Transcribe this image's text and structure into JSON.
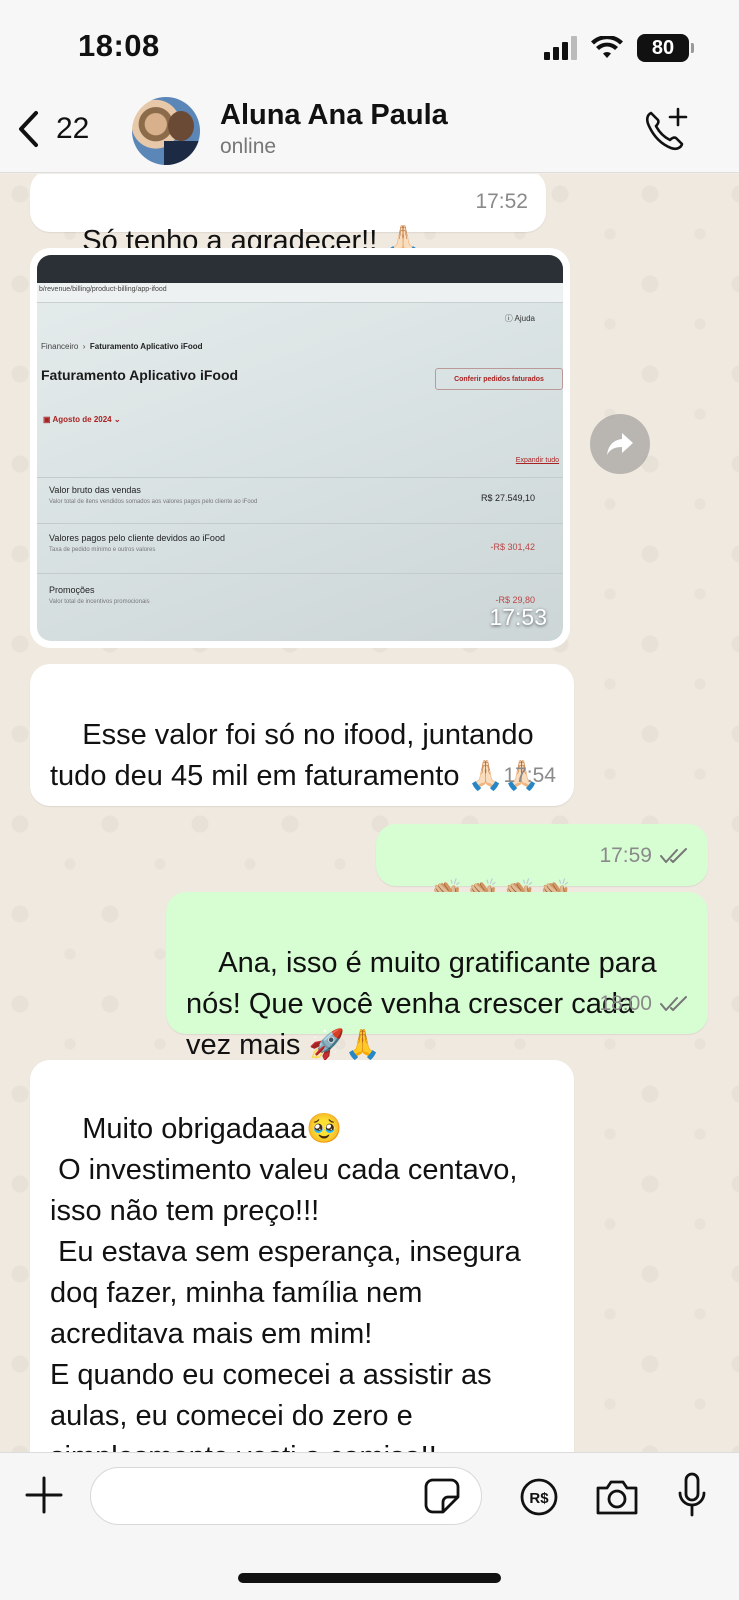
{
  "status_bar": {
    "time": "18:08",
    "battery": "80"
  },
  "header": {
    "back_count": "22",
    "contact_name": "Aluna Ana Paula",
    "contact_status": "online"
  },
  "messages": [
    {
      "direction": "in",
      "text": "Só tenho a agradecer!! 🙏🏻",
      "time": "17:52"
    },
    {
      "direction": "in",
      "type": "image",
      "time": "17:53",
      "image": {
        "url": "b/revenue/billing/product-billing/app-ifood",
        "help": "Ajuda",
        "breadcrumb_root": "Financeiro",
        "breadcrumb_current": "Faturamento Aplicativo iFood",
        "title": "Faturamento Aplicativo iFood",
        "action": "Conferir pedidos faturados",
        "month": "Agosto de 2024",
        "expand": "Expandir tudo",
        "rows": [
          {
            "label": "Valor bruto das vendas",
            "sub": "Valor total de itens vendidos somados aos valores pagos pelo cliente ao iFood",
            "value": "R$ 27.549,10"
          },
          {
            "label": "Valores pagos pelo cliente devidos ao iFood",
            "sub": "Taxa de pedido mínimo e outros valores",
            "value": "-R$ 301,42"
          },
          {
            "label": "Promoções",
            "sub": "Valor total de incentivos promocionais",
            "value": "-R$ 29,80"
          }
        ]
      }
    },
    {
      "direction": "in",
      "text": "Esse valor foi só no ifood, juntando tudo deu 45 mil em faturamento 🙏🏻🙏🏻",
      "time": "17:54"
    },
    {
      "direction": "out",
      "text": "👏🏼👏🏼👏🏼👏🏼",
      "time": "17:59"
    },
    {
      "direction": "out",
      "text": "Ana, isso é muito gratificante para nós! Que você venha crescer cada vez mais 🚀🙏",
      "time": "18:00"
    },
    {
      "direction": "in",
      "text": "Muito obrigadaaa🥹\n O investimento valeu cada centavo, isso não tem preço!!!\n Eu estava sem esperança, insegura doq fazer, minha família nem acreditava mais em mim!\nE quando eu comecei a assistir as aulas, eu comecei do zero e simplesmente vesti a camisa!!"
    }
  ],
  "icons": {
    "back": "chevron-left-icon",
    "call": "phone-add-icon",
    "forward": "forward-arrow-icon",
    "plus": "plus-icon",
    "sticker": "sticker-icon",
    "pay": "pix-payment-icon",
    "camera": "camera-icon",
    "mic": "microphone-icon"
  },
  "colors": {
    "incoming_bubble": "#ffffff",
    "outgoing_bubble": "#d7fdd3",
    "chat_background": "#efe9e0"
  }
}
